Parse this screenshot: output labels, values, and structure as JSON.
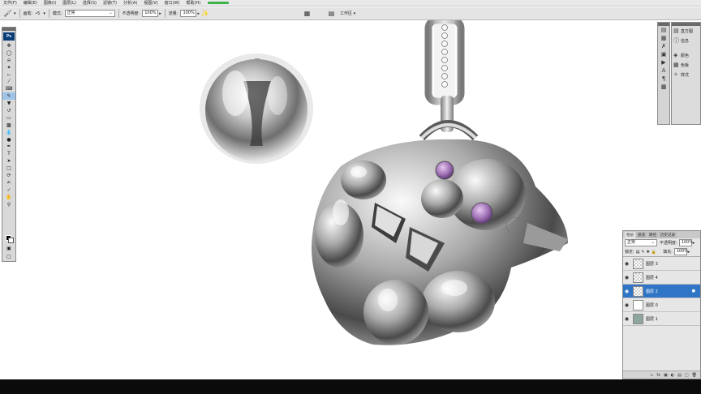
{
  "menu": {
    "items": [
      "文件(F)",
      "编辑(E)",
      "图像(I)",
      "图层(L)",
      "选择(S)",
      "滤镜(T)",
      "分析(A)",
      "视图(V)",
      "窗口(W)",
      "帮助(H)"
    ]
  },
  "options_bar": {
    "brush_label": "画笔:",
    "brush_size": "5",
    "mode_label": "模式:",
    "mode_value": "正常",
    "opacity_label": "不透明度:",
    "opacity_value": "100%",
    "flow_label": "流量:",
    "flow_value": "100%",
    "workspace_label": "工作区"
  },
  "toolbox": {
    "logo": "Ps"
  },
  "panels": {
    "items": [
      {
        "icon": "histogram-icon",
        "label": "直方图"
      },
      {
        "icon": "info-icon",
        "label": "信息"
      },
      {
        "icon": "color-icon",
        "label": "颜色"
      },
      {
        "icon": "swatches-icon",
        "label": "色板"
      },
      {
        "icon": "styles-icon",
        "label": "样式"
      }
    ]
  },
  "layers_panel": {
    "tabs": [
      "图层",
      "通道",
      "路径",
      "历史记录"
    ],
    "blend_mode": "正常",
    "opacity_label": "不透明度:",
    "opacity_value": "100%",
    "lock_label": "锁定:",
    "fill_label": "填充:",
    "fill_value": "100%",
    "layers": [
      {
        "name": "图层 3",
        "thumb": "transparent",
        "selected": false
      },
      {
        "name": "图层 4",
        "thumb": "transparent",
        "selected": false
      },
      {
        "name": "图层 2",
        "thumb": "transparent",
        "selected": true
      },
      {
        "name": "图层 0",
        "thumb": "white",
        "selected": false
      },
      {
        "name": "图层 1",
        "thumb": "image",
        "selected": false
      }
    ],
    "footer_icons": [
      "link-icon",
      "fx-icon",
      "mask-icon",
      "adjustment-icon",
      "group-icon",
      "new-layer-icon",
      "trash-icon"
    ]
  },
  "colors": {
    "selection": "#2f74c5",
    "progress": "#3cb24a",
    "ps_logo_bg": "#0a3c74",
    "gem": "#9b6cb2"
  }
}
